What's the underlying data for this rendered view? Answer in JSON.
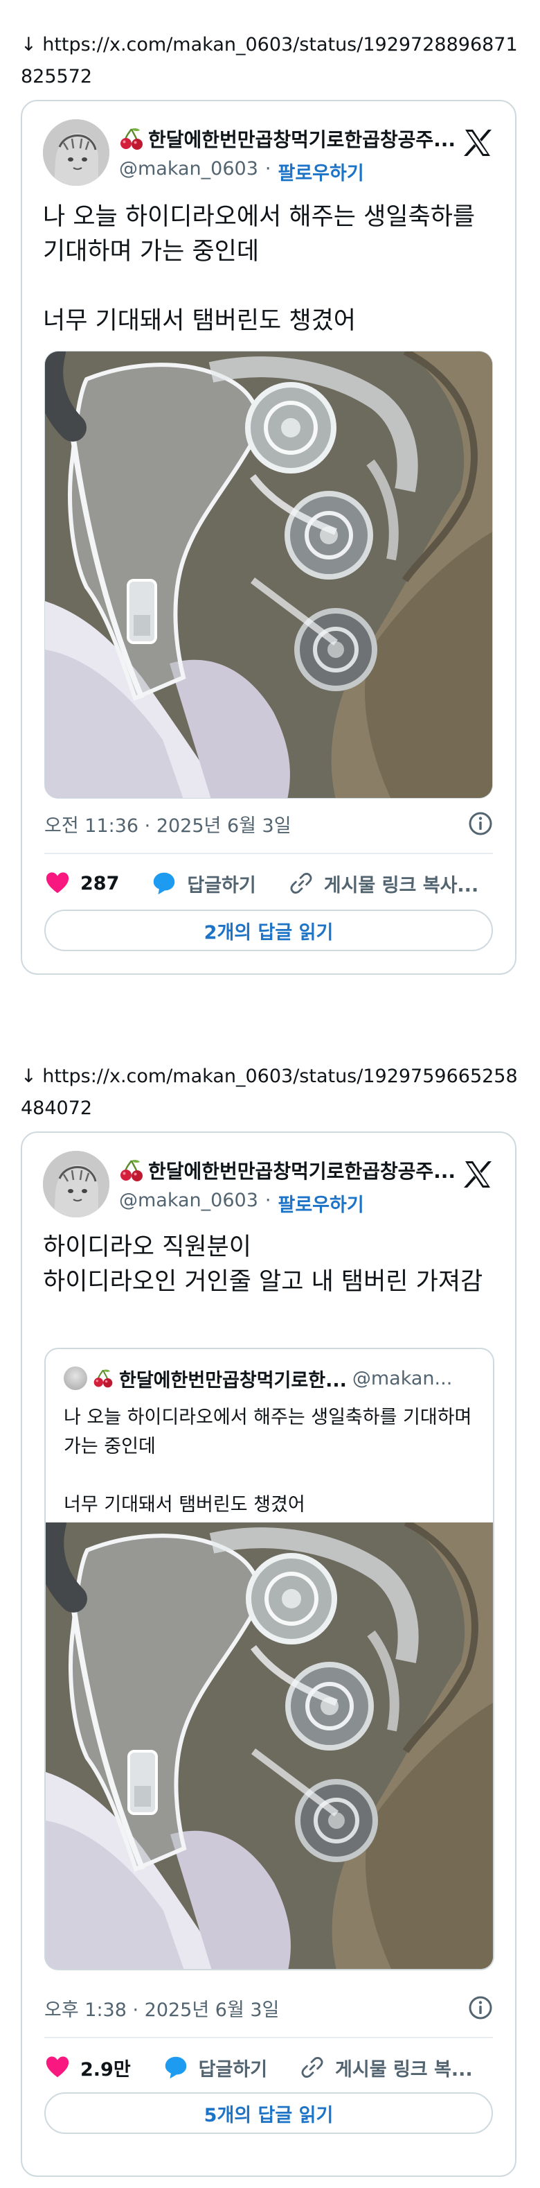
{
  "posts": [
    {
      "url_line": "↓ https://x.com/makan_0603/status/1929728896871825572",
      "author": {
        "display_name": "한달에한번만곱창먹기로한곱창공주...",
        "handle": "@makan_0603",
        "separator": "·",
        "follow_label": "팔로우하기"
      },
      "text": "나 오늘 하이디라오에서 해주는 생일축하를 기대하며 가는 중인데\n\n너무 기대돼서 탬버린도 챙겼어",
      "timestamp": "오전 11:36 · 2025년 6월 3일",
      "likes": "287",
      "reply_label": "답글하기",
      "copy_link_label": "게시물 링크 복사...",
      "read_replies": "2개의 답글 읽기"
    },
    {
      "url_line": "↓ https://x.com/makan_0603/status/1929759665258484072",
      "author": {
        "display_name": "한달에한번만곱창먹기로한곱창공주...",
        "handle": "@makan_0603",
        "separator": "·",
        "follow_label": "팔로우하기"
      },
      "text": "하이디라오 직원분이\n하이디라오인 거인줄 알고 내 탬버린 가져감",
      "quote": {
        "display_name": "한달에한번만곱창먹기로한...",
        "handle": "@makan...",
        "text": "나 오늘 하이디라오에서 해주는 생일축하를 기대하며 가는 중인데\n\n너무 기대돼서 탬버린도 챙겼어"
      },
      "timestamp": "오후 1:38 · 2025년 6월 3일",
      "likes": "2.9만",
      "reply_label": "답글하기",
      "copy_link_label": "게시물 링크 복...",
      "read_replies": "5개의 답글 읽기"
    }
  ],
  "icons": {
    "emoji": "cherry-icon",
    "logo": "x-logo-icon",
    "info": "info-icon",
    "like": "heart-icon",
    "reply": "speech-bubble-icon",
    "link": "link-icon"
  },
  "colors": {
    "accent": "#1d74c7",
    "like": "#f91880",
    "reply": "#1d9bf0",
    "muted": "#536471",
    "border": "#cfd9de"
  }
}
